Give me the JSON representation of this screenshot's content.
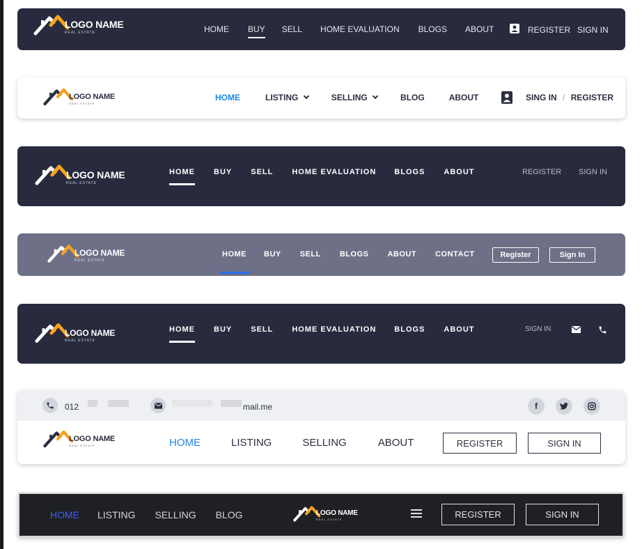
{
  "logo": {
    "name": "LOGO NAME",
    "tagline": "REAL ESTATE"
  },
  "header1": {
    "nav": [
      "HOME",
      "BUY",
      "SELL",
      "HOME EVALUATION",
      "BLOGS",
      "ABOUT"
    ],
    "register": "REGISTER",
    "signin": "SIGN IN",
    "user_icon": "user-badge-icon"
  },
  "header2": {
    "nav": [
      "HOME",
      "LISTING",
      "SELLING",
      "BLOG",
      "ABOUT"
    ],
    "signin": "SING IN",
    "separator": "/",
    "register": "REGISTER",
    "user_icon": "user-badge-icon",
    "active_color": "#1e88e5"
  },
  "header3": {
    "nav": [
      "HOME",
      "BUY",
      "SELL",
      "HOME EVALUATION",
      "BLOGS",
      "ABOUT"
    ],
    "register": "REGISTER",
    "signin": "SIGN IN"
  },
  "header4": {
    "nav": [
      "HOME",
      "BUY",
      "SELL",
      "BLOGS",
      "ABOUT",
      "CONTACT"
    ],
    "register": "Register",
    "signin": "Sign In",
    "active_color": "#2a6ff0"
  },
  "header5": {
    "nav": [
      "HOME",
      "BUY",
      "SELL",
      "HOME EVALUATION",
      "BLOGS",
      "ABOUT"
    ],
    "signin": "SIGN IN",
    "mail_icon": "mail-icon",
    "phone_icon": "phone-icon"
  },
  "header6": {
    "topbar": {
      "phone": "012",
      "email": "mail.me",
      "social": [
        "facebook-icon",
        "twitter-icon",
        "instagram-icon"
      ]
    },
    "nav": [
      "HOME",
      "LISTING",
      "SELLING",
      "ABOUT"
    ],
    "register": "REGISTER",
    "signin": "SIGN IN",
    "active_color": "#1e88e5"
  },
  "header7": {
    "nav": [
      "HOME",
      "LISTING",
      "SELLING",
      "BLOG"
    ],
    "register": "REGISTER",
    "signin": "SIGN IN",
    "menu_icon": "hamburger-menu-icon",
    "active_color": "#3f5ff0"
  },
  "colors": {
    "dark": "#282b3e",
    "grey": "#6d7087",
    "accent": "#f6a21d",
    "background": "#ffffff"
  }
}
